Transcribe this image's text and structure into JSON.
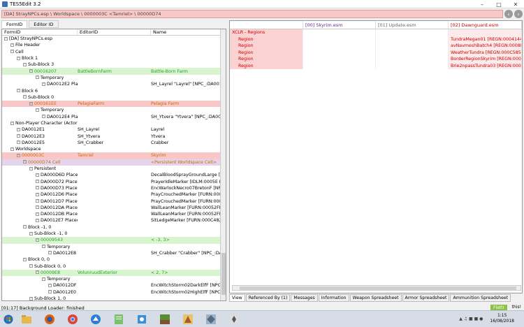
{
  "window": {
    "title": "TES5Edit 3.2"
  },
  "pathbar": {
    "text": "[DA] StrayNPCs.esp \\ Worldspace \\ 0000003C <Tamriel> \\ 00000D74"
  },
  "left_tabs": [
    "FormID",
    "Editor ID"
  ],
  "tree": {
    "headers": [
      "FormID",
      "EditorID",
      "Name"
    ],
    "rows": [
      {
        "c1": "[DA] StrayNPCs.esp",
        "c2": "",
        "c3": "",
        "indent": 0,
        "style": ""
      },
      {
        "c1": "File Header",
        "c2": "",
        "c3": "",
        "indent": 1,
        "style": ""
      },
      {
        "c1": "Cell",
        "c2": "",
        "c3": "",
        "indent": 1,
        "style": ""
      },
      {
        "c1": "Block 1",
        "c2": "",
        "c3": "",
        "indent": 2,
        "style": ""
      },
      {
        "c1": "Sub-Block 3",
        "c2": "",
        "c3": "",
        "indent": 3,
        "style": ""
      },
      {
        "c1": "00016207",
        "c2": "BattleBornFarm",
        "c3": "Battle-Born Farm",
        "indent": 4,
        "style": "green"
      },
      {
        "c1": "Temporary",
        "c2": "",
        "c3": "",
        "indent": 5,
        "style": ""
      },
      {
        "c1": "DA0012E2  Placed NPC",
        "c2": "",
        "c3": "SH_Layrel \"Layrel\" [NPC_:DA0012...",
        "indent": 6,
        "style": ""
      },
      {
        "c1": "Block 6",
        "c2": "",
        "c3": "",
        "indent": 2,
        "style": ""
      },
      {
        "c1": "Sub-Block 0",
        "c2": "",
        "c3": "",
        "indent": 3,
        "style": ""
      },
      {
        "c1": "000161EE",
        "c2": "PelagiaFarm",
        "c3": "Pelagia Farm",
        "indent": 4,
        "style": "pink"
      },
      {
        "c1": "Temporary",
        "c2": "",
        "c3": "",
        "indent": 5,
        "style": ""
      },
      {
        "c1": "DA0012E4  Placed NPC",
        "c2": "",
        "c3": "SH_Ytvera \"Ytvera\" [NPC_:DA0012...",
        "indent": 6,
        "style": ""
      },
      {
        "c1": "Non-Player Character (Actor)",
        "c2": "",
        "c3": "",
        "indent": 1,
        "style": ""
      },
      {
        "c1": "DA0012E1",
        "c2": "SH_Layrel",
        "c3": "Layrel",
        "indent": 2,
        "style": ""
      },
      {
        "c1": "DA0012E3",
        "c2": "SH_Ytvera",
        "c3": "Ytvera",
        "indent": 2,
        "style": ""
      },
      {
        "c1": "DA0012E5",
        "c2": "SH_Crabber",
        "c3": "Crabber",
        "indent": 2,
        "style": ""
      },
      {
        "c1": "Worldspace",
        "c2": "",
        "c3": "",
        "indent": 1,
        "style": ""
      },
      {
        "c1": "0000003C",
        "c2": "Tamriel",
        "c3": "Skyrim",
        "indent": 2,
        "style": "pink"
      },
      {
        "c1": "00000D74  Cell",
        "c2": "",
        "c3": "<Persistent Worldspace Cell>",
        "indent": 3,
        "style": "sel"
      },
      {
        "c1": "Persistent",
        "c2": "",
        "c3": "",
        "indent": 4,
        "style": ""
      },
      {
        "c1": "DA000D6D  Placed Object",
        "c2": "",
        "c3": "DecalBloodSprayGroundLarge [T...",
        "indent": 5,
        "style": ""
      },
      {
        "c1": "DA000D72  Placed Object",
        "c2": "",
        "c3": "PrayerIdleMarker [IDLM:0005E F7A]",
        "indent": 5,
        "style": ""
      },
      {
        "c1": "DA000D73  Placed NPC",
        "c2": "",
        "c3": "EncWarlockNecro07BretonF [NP...",
        "indent": 5,
        "style": ""
      },
      {
        "c1": "DA0012D6  Placed Object",
        "c2": "",
        "c3": "PrayCrouchedMarker [FURN:000...",
        "indent": 5,
        "style": ""
      },
      {
        "c1": "DA0012D7  Placed Object",
        "c2": "",
        "c3": "PrayCrouchedMarker [FURN:000...",
        "indent": 5,
        "style": ""
      },
      {
        "c1": "DA0012DA  Placed Object",
        "c2": "",
        "c3": "WallLeanMarker [FURN:00052FF5]",
        "indent": 5,
        "style": ""
      },
      {
        "c1": "DA0012DB  Placed Object",
        "c2": "",
        "c3": "WallLeanMarker [FURN:00052FF5]",
        "indent": 5,
        "style": ""
      },
      {
        "c1": "DA0012E7  Placed Object",
        "c2": "",
        "c3": "SitLedgeMarker [FURN:000C4827]",
        "indent": 5,
        "style": ""
      },
      {
        "c1": "Block -1, 0",
        "c2": "",
        "c3": "",
        "indent": 3,
        "style": ""
      },
      {
        "c1": "Sub-Block -1, 0",
        "c2": "",
        "c3": "",
        "indent": 4,
        "style": ""
      },
      {
        "c1": "00009543",
        "c2": "",
        "c3": "< -3,  3>",
        "indent": 5,
        "style": "green"
      },
      {
        "c1": "Temporary",
        "c2": "",
        "c3": "",
        "indent": 6,
        "style": ""
      },
      {
        "c1": "DA0012E8  Placed NPC",
        "c2": "",
        "c3": "SH_Crabber \"Crabber\" [NPC_:DA...",
        "indent": 7,
        "style": ""
      },
      {
        "c1": "Block 0, 0",
        "c2": "",
        "c3": "",
        "indent": 3,
        "style": ""
      },
      {
        "c1": "Sub-Block 0, 0",
        "c2": "",
        "c3": "",
        "indent": 4,
        "style": ""
      },
      {
        "c1": "00009E8",
        "c2": "VolunruudExterior",
        "c3": "<  2,  7>",
        "indent": 5,
        "style": "green"
      },
      {
        "c1": "Temporary",
        "c2": "",
        "c3": "",
        "indent": 6,
        "style": ""
      },
      {
        "c1": "DA0012DF  Placed NPC",
        "c2": "",
        "c3": "EncWitchStorm02DarkElfF [NPC...",
        "indent": 7,
        "style": ""
      },
      {
        "c1": "DA0012E0  Placed NPC",
        "c2": "",
        "c3": "EncWitchStorm02HighElfF [NPC...",
        "indent": 7,
        "style": ""
      },
      {
        "c1": "Sub-Block 1, 0",
        "c2": "",
        "c3": "",
        "indent": 4,
        "style": ""
      }
    ]
  },
  "record_view": {
    "headers": [
      "",
      "[00] Skyrim.esm",
      "[01] Update.esm",
      "[02] Dawnguard.esm"
    ],
    "rows": [
      {
        "label": "XCLR - Regions",
        "v0": "",
        "v1": "",
        "v2": ""
      },
      {
        "label": "Region",
        "v0": "",
        "v1": "",
        "v2": "TundraMegan01 [REGN:00041449]"
      },
      {
        "label": "Region",
        "v0": "",
        "v1": "",
        "v2": "avNavmeshBatch4 [REGN:0008E..."
      },
      {
        "label": "Region",
        "v0": "",
        "v1": "",
        "v2": "WeatherTundra [REGN:000C5858]"
      },
      {
        "label": "Region",
        "v0": "",
        "v1": "",
        "v2": "BorderRegionSkyrim [REGN:000C..."
      },
      {
        "label": "Region",
        "v0": "",
        "v1": "",
        "v2": "Brie2npassTundra03 [REGN:000..."
      }
    ]
  },
  "bottom_tabs": [
    "View",
    "Referenced By (1)",
    "Messages",
    "Information",
    "Weapon Spreadsheet",
    "Armor Spreadsheet",
    "Ammunition Spreadsheet"
  ],
  "status": {
    "text": "[01:17] Background Loader: finished",
    "flattr": "Flattr",
    "this": "this!"
  },
  "clock": {
    "time": "1:15",
    "date": "16/08/2018"
  }
}
